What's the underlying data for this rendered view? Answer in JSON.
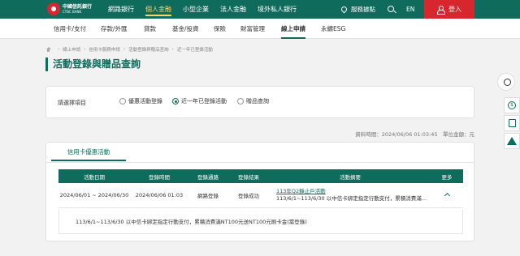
{
  "header": {
    "brand_cn": "中國信託銀行",
    "brand_en": "CTBC BANK",
    "nav": [
      "網路銀行",
      "個人金融",
      "小型企業",
      "法人金融",
      "境外私人銀行"
    ],
    "active_nav": "個人金融",
    "service_label": "服務據點",
    "lang_label": "EN",
    "login_label": "登入",
    "accent": "#0f6b5c",
    "login_color": "#d7262e"
  },
  "subnav": {
    "items": [
      "信用卡/支付",
      "存款/外匯",
      "貸款",
      "基金/投資",
      "保險",
      "財富管理",
      "線上申請",
      "永續ESG"
    ],
    "active": "線上申請"
  },
  "breadcrumb": [
    "線上申請",
    "信用卡服務申請",
    "活動登錄與贈品查詢",
    "近一年已登錄活動"
  ],
  "page_title": "活動登錄與贈品查詢",
  "filter": {
    "label": "請選擇項目",
    "options": [
      "優惠活動登錄",
      "近一年已登錄活動",
      "贈品查詢"
    ],
    "selected": "近一年已登錄活動"
  },
  "meta_text": "資料時間：2024/06/06 01:03:45　單位金額：元",
  "results": {
    "tab_label": "信用卡優惠活動",
    "columns": [
      "活動日期",
      "登錄時間",
      "登錄通路",
      "登錄結果",
      "活動摘要",
      "更多"
    ],
    "rows": [
      {
        "date": "2024/06/01 ~ 2024/06/30",
        "time": "2024/06/06 01:03",
        "channel": "網路登錄",
        "result": "登錄成功",
        "summary_link": "113年Q2靜止戶活動",
        "summary_text": "113/6/1~113/6/30 以中信卡綁定指定行動支付，累積消費滿..."
      }
    ],
    "detail_text": "113/6/1~113/6/30 以中信卡綁定指定行動支付，累積消費滿NT100元送NT100元刷卡金(需登錄)"
  },
  "side_tools": [
    "mascot-icon",
    "coin-icon",
    "calculator-icon",
    "warning-icon"
  ]
}
